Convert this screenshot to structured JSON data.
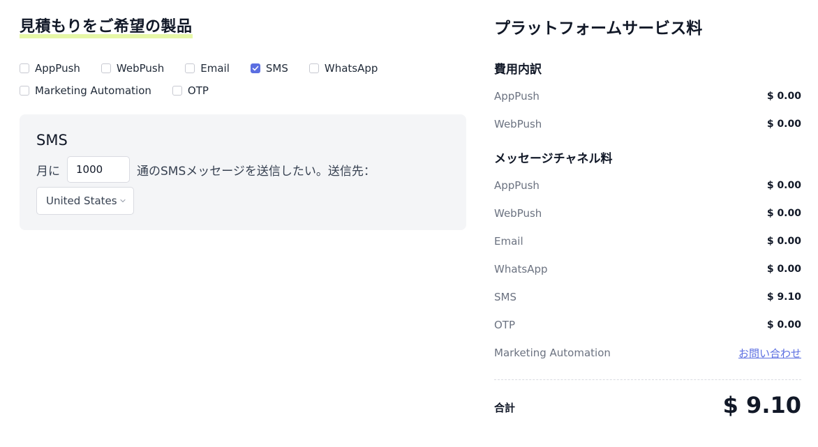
{
  "left": {
    "title": "見積もりをご希望の製品",
    "products": [
      {
        "label": "AppPush",
        "checked": false
      },
      {
        "label": "WebPush",
        "checked": false
      },
      {
        "label": "Email",
        "checked": false
      },
      {
        "label": "SMS",
        "checked": true
      },
      {
        "label": "WhatsApp",
        "checked": false
      },
      {
        "label": "Marketing Automation",
        "checked": false
      },
      {
        "label": "OTP",
        "checked": false
      }
    ],
    "sms_panel": {
      "title": "SMS",
      "prefix": "月に",
      "quantity": "1000",
      "suffix": "通のSMSメッセージを送信したい。送信先：",
      "country": "United States"
    }
  },
  "right": {
    "title": "プラットフォームサービス料",
    "breakdown": {
      "title": "費用内訳",
      "rows": [
        {
          "label": "AppPush",
          "value": "$ 0.00"
        },
        {
          "label": "WebPush",
          "value": "$ 0.00"
        }
      ]
    },
    "channel_fees": {
      "title": "メッセージチャネル料",
      "rows": [
        {
          "label": "AppPush",
          "value": "$ 0.00"
        },
        {
          "label": "WebPush",
          "value": "$ 0.00"
        },
        {
          "label": "Email",
          "value": "$ 0.00"
        },
        {
          "label": "WhatsApp",
          "value": "$ 0.00"
        },
        {
          "label": "SMS",
          "value": "$ 9.10"
        },
        {
          "label": "OTP",
          "value": "$ 0.00"
        }
      ],
      "marketing_label": "Marketing Automation",
      "marketing_link": "お問い合わせ"
    },
    "total_label": "合計",
    "total_value": "$ 9.10"
  },
  "colors": {
    "accent": "#5b6ee1",
    "title_highlight": "#e6f7a6",
    "panel_bg": "#f4f5f7"
  }
}
